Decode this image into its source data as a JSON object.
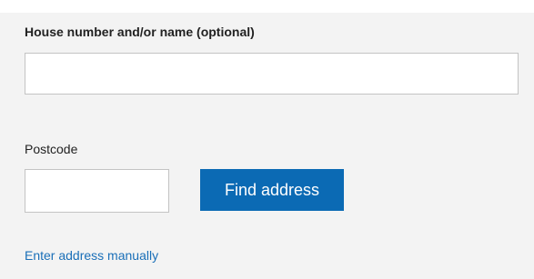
{
  "form": {
    "house_label": "House number and/or name (optional)",
    "house_value": "",
    "postcode_label": "Postcode",
    "postcode_value": "",
    "find_button_label": "Find address",
    "manual_link_label": "Enter address manually"
  },
  "colors": {
    "panel_background": "#f3f3f3",
    "button_background": "#0b6ab4",
    "link": "#1a6fb8"
  }
}
